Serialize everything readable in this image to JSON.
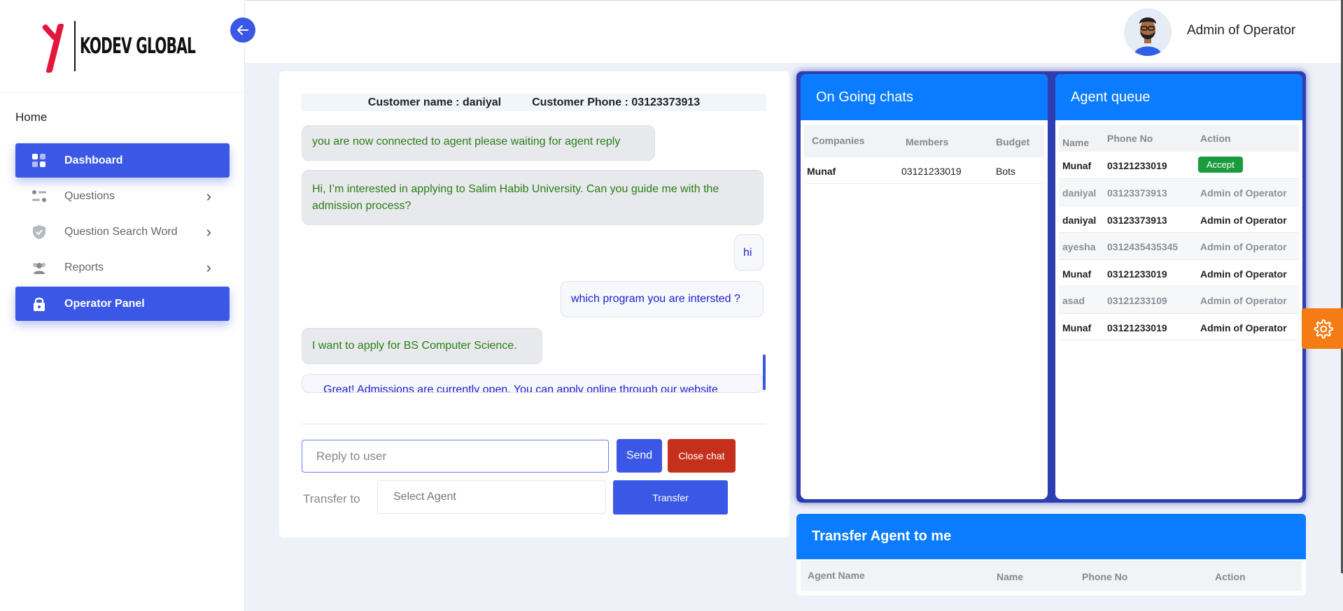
{
  "brand": {
    "logo_text": "KODEV GLOBAL",
    "accent": "#3b57e6",
    "header_blue": "#0b7cff"
  },
  "sidebar": {
    "section_title": "Home",
    "items": [
      {
        "label": "Dashboard",
        "icon": "grid-icon",
        "active": true
      },
      {
        "label": "Questions",
        "icon": "list-toggle-icon",
        "active": false,
        "has_submenu": true
      },
      {
        "label": "Question Search Word",
        "icon": "shield-check-icon",
        "active": false,
        "has_submenu": true
      },
      {
        "label": "Reports",
        "icon": "users-icon",
        "active": false,
        "has_submenu": true
      },
      {
        "label": "Operator Panel",
        "icon": "lock-icon",
        "active": true
      }
    ]
  },
  "header": {
    "user_name": "Admin of Operator"
  },
  "chat": {
    "customer_name": "Customer name : daniyal",
    "customer_phone": "Customer Phone : 03123373913",
    "messages": [
      {
        "from": "bot",
        "text": "you are now connected to agent please waiting for agent reply"
      },
      {
        "from": "bot",
        "text": "Hi, I’m interested in applying to Salim Habib University. Can you guide me with the admission process?"
      },
      {
        "from": "agent",
        "text": "hi"
      },
      {
        "from": "agent",
        "text": "which program you are intersted ?"
      },
      {
        "from": "bot",
        "text": "I want to apply for BS Computer Science."
      },
      {
        "from": "agent",
        "text": "Great! Admissions are currently open. You can apply online through our website"
      }
    ],
    "reply_placeholder": "Reply to user",
    "send_label": "Send",
    "close_label": "Close chat",
    "transfer_to_label": "Transfer to",
    "select_agent_placeholder": "Select Agent",
    "transfer_label": "Transfer"
  },
  "ongoing": {
    "title": "On Going chats",
    "columns": [
      "Companies",
      "Members",
      "Budget"
    ],
    "rows": [
      [
        "Munaf",
        "03121233019",
        "Bots"
      ]
    ]
  },
  "queue": {
    "title": "Agent queue",
    "columns": [
      "Name",
      "Phone No",
      "Action"
    ],
    "rows": [
      {
        "name": "Munaf",
        "phone": "03121233019",
        "action": "Accept"
      },
      {
        "name": "daniyal",
        "phone": "03123373913",
        "action": "Admin of Operator"
      },
      {
        "name": "daniyal",
        "phone": "03123373913",
        "action": "Admin of Operator"
      },
      {
        "name": "ayesha",
        "phone": "0312435435345",
        "action": "Admin of Operator"
      },
      {
        "name": "Munaf",
        "phone": "03121233019",
        "action": "Admin of Operator"
      },
      {
        "name": "asad",
        "phone": "03121233109",
        "action": "Admin of Operator"
      },
      {
        "name": "Munaf",
        "phone": "03121233019",
        "action": "Admin of Operator"
      }
    ]
  },
  "transfer_agent": {
    "title": "Transfer Agent to me",
    "columns": [
      "Agent Name",
      "Name",
      "Phone No",
      "Action"
    ]
  }
}
